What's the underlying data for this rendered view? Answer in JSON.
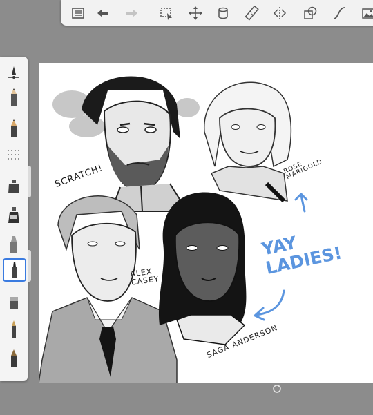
{
  "toolbar": {
    "buttons": [
      {
        "name": "list-icon"
      },
      {
        "name": "undo-icon"
      },
      {
        "name": "redo-icon"
      },
      {
        "name": "selection-icon"
      },
      {
        "name": "transform-icon"
      },
      {
        "name": "layer-icon"
      },
      {
        "name": "ruler-icon"
      },
      {
        "name": "symmetry-icon"
      },
      {
        "name": "shape-icon"
      },
      {
        "name": "curve-icon"
      },
      {
        "name": "image-icon"
      }
    ]
  },
  "palette": {
    "selected_brush": "brush-pen",
    "brushes": [
      "brush-settings",
      "pencil",
      "hard-pencil",
      "texture",
      "ink-bottle",
      "fill-bottle",
      "marker",
      "brush-pen",
      "eraser",
      "fountain-pen",
      "nib-pen"
    ]
  },
  "canvas": {
    "labels": {
      "scratch": "SCRATCH!",
      "rose": "ROSE\nMARIGOLD",
      "alex": "ALEX\nCASEY",
      "saga": "SAGA ANDERSON",
      "yay": "YAY\nLADIES!"
    }
  },
  "colors": {
    "accent_blue": "#5b95df",
    "selection_blue": "#3a7be0",
    "workspace_gray": "#8c8c8c"
  }
}
